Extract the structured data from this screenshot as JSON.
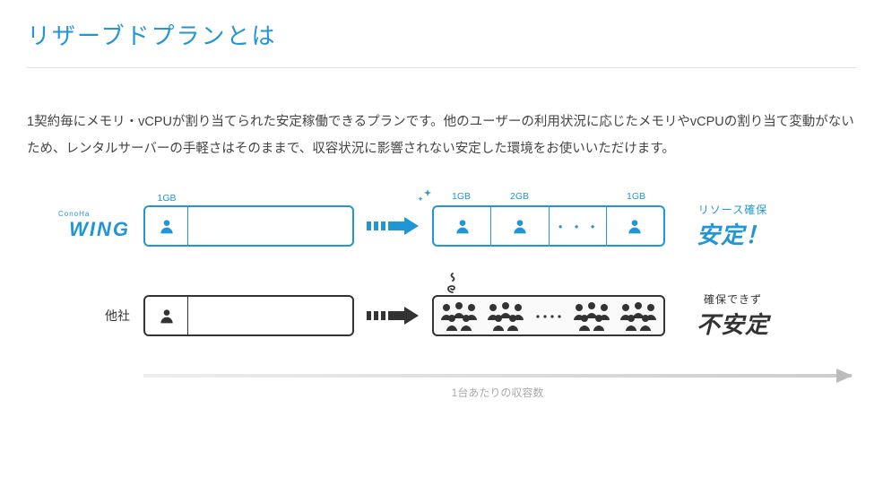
{
  "heading": "リザーブドプランとは",
  "description": "1契約毎にメモリ・vCPUが割り当てられた安定稼働できるプランです。他のユーザーの利用状況に応じたメモリやvCPUの割り当て変動がないため、レンタルサーバーの手軽さはそのままで、収容状況に影響されない安定した環境をお使いいただけます。",
  "brand": {
    "sup": "ConoHa",
    "name": "WING"
  },
  "other_label": "他社",
  "capacities": {
    "single": "1GB",
    "multi": [
      "1GB",
      "2GB",
      "",
      "1GB"
    ]
  },
  "dots": "・・・",
  "results": {
    "stable_sup": "リソース確保",
    "stable_main": "安定！",
    "unstable_sup": "確保できず",
    "unstable_main": "不安定"
  },
  "axis_label": "1台あたりの収容数"
}
